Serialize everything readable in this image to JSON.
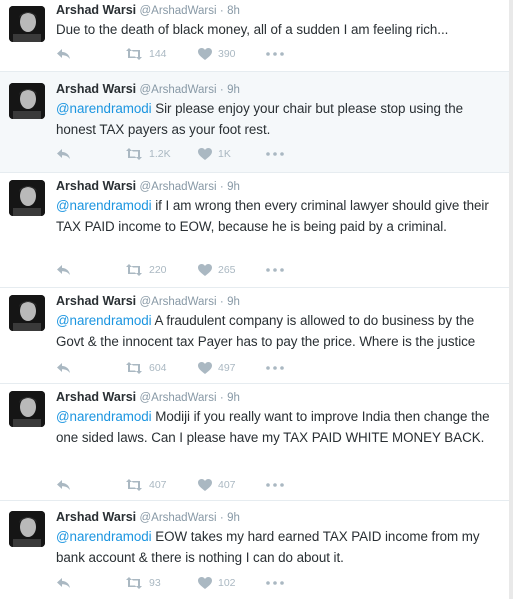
{
  "tweets": [
    {
      "name": "Arshad Warsi",
      "handle": "@ArshadWarsi",
      "separator": "·",
      "time": "8h",
      "mention": "",
      "text": "Due to the death of black money, all of a sudden I am feeling rich...",
      "retweets": "144",
      "likes": "390"
    },
    {
      "name": "Arshad Warsi",
      "handle": "@ArshadWarsi",
      "separator": "·",
      "time": "9h",
      "mention": "@narendramodi",
      "text": " Sir please enjoy your chair but please stop using the honest TAX payers as your foot rest.",
      "retweets": "1.2K",
      "likes": "1K"
    },
    {
      "name": "Arshad Warsi",
      "handle": "@ArshadWarsi",
      "separator": "·",
      "time": "9h",
      "mention": "@narendramodi",
      "text": " if I am wrong then every criminal lawyer should give their TAX PAID income to EOW, because he is being paid by a criminal.",
      "retweets": "220",
      "likes": "265"
    },
    {
      "name": "Arshad Warsi",
      "handle": "@ArshadWarsi",
      "separator": "·",
      "time": "9h",
      "mention": "@narendramodi",
      "text": " A fraudulent company is allowed to do business by the Govt & the innocent tax Payer has to pay the price. Where is the justice",
      "retweets": "604",
      "likes": "497"
    },
    {
      "name": "Arshad Warsi",
      "handle": "@ArshadWarsi",
      "separator": "·",
      "time": "9h",
      "mention": "@narendramodi",
      "text": " Modiji if you really want to improve India then change the one sided laws. Can I please have my TAX PAID WHITE MONEY BACK.",
      "retweets": "407",
      "likes": "407"
    },
    {
      "name": "Arshad Warsi",
      "handle": "@ArshadWarsi",
      "separator": "·",
      "time": "9h",
      "mention": "@narendramodi",
      "text": " EOW takes my hard earned TAX PAID income from my bank account & there is nothing I can do about it.",
      "retweets": "93",
      "likes": "102"
    }
  ],
  "icons": {
    "reply": "reply-icon",
    "retweet": "retweet-icon",
    "like": "heart-icon",
    "more": "more-icon"
  },
  "colors": {
    "mention": "#1b95e0",
    "action_gray": "#aab8c2",
    "meta_gray": "#8899a6",
    "highlight_bg": "#f5f8fa"
  }
}
